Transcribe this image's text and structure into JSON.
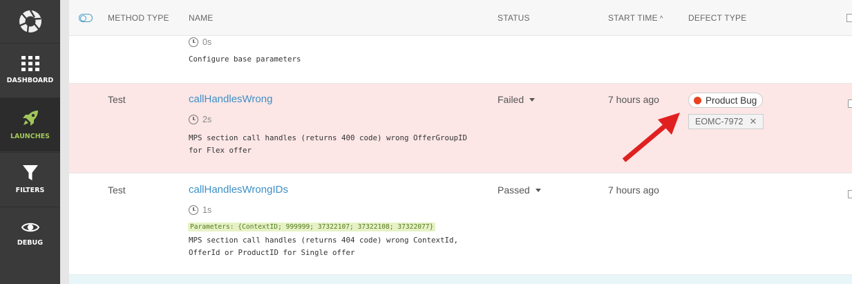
{
  "sidebar": {
    "items": [
      {
        "label": "DASHBOARD",
        "icon": "dashboard-grid-icon"
      },
      {
        "label": "LAUNCHES",
        "icon": "rocket-icon"
      },
      {
        "label": "FILTERS",
        "icon": "funnel-icon"
      },
      {
        "label": "DEBUG",
        "icon": "eye-icon"
      }
    ]
  },
  "table": {
    "columns": {
      "method_type": "METHOD TYPE",
      "name": "NAME",
      "status": "STATUS",
      "start_time": "START TIME",
      "defect_type": "DEFECT TYPE"
    },
    "rows": [
      {
        "duration": "0s",
        "description": "Configure base parameters"
      },
      {
        "method_type": "Test",
        "name": "callHandlesWrong",
        "duration": "2s",
        "description_line1": "MPS section call handles (returns 400 code) wrong OfferGroupID",
        "description_line2": "for Flex offer",
        "status": "Failed",
        "start_time": "7 hours ago",
        "defect_type": "Product Bug",
        "issue": "EOMC-7972"
      },
      {
        "method_type": "Test",
        "name": "callHandlesWrongIDs",
        "duration": "1s",
        "parameters": "Parameters: {ContextID; 999999; 37322107; 37322108; 37322077}",
        "description_line1": "MPS section call handles (returns 404 code) wrong ContextId,",
        "description_line2": "OfferId or ProductID for Single offer",
        "status": "Passed",
        "start_time": "7 hours ago"
      }
    ]
  },
  "colors": {
    "sidebar_bg": "#3a3a3a",
    "active_accent": "#a2c65a",
    "failed_row_bg": "#fce6e6",
    "link": "#3d8fc6",
    "product_bug_dot": "#e8421f",
    "annotation_arrow": "#e02020"
  }
}
